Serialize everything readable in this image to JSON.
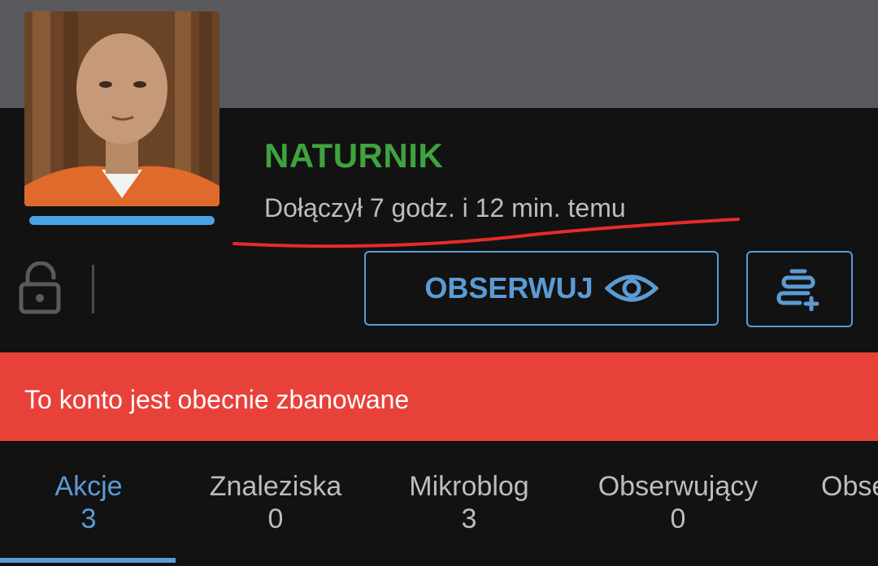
{
  "profile": {
    "username": "NATURNIK",
    "joined_text": "Dołączył 7 godz. i 12 min. temu"
  },
  "actions": {
    "observe_label": "OBSERWUJ",
    "observe_icon": "eye-icon",
    "add_to_list_icon": "add-to-list-icon",
    "lock_icon": "lock-icon"
  },
  "banner": {
    "text": "To konto jest obecnie zbanowane"
  },
  "tabs": [
    {
      "label": "Akcje",
      "count": "3"
    },
    {
      "label": "Znaleziska",
      "count": "0"
    },
    {
      "label": "Mikroblog",
      "count": "3"
    },
    {
      "label": "Obserwujący",
      "count": "0"
    },
    {
      "label": "Obse",
      "count": ""
    }
  ],
  "colors": {
    "username": "#3fa33f",
    "accent": "#5b9bd5",
    "rank_bar": "#4aa3e8",
    "banner": "#e8413a",
    "annotation": "#e82a2a"
  }
}
